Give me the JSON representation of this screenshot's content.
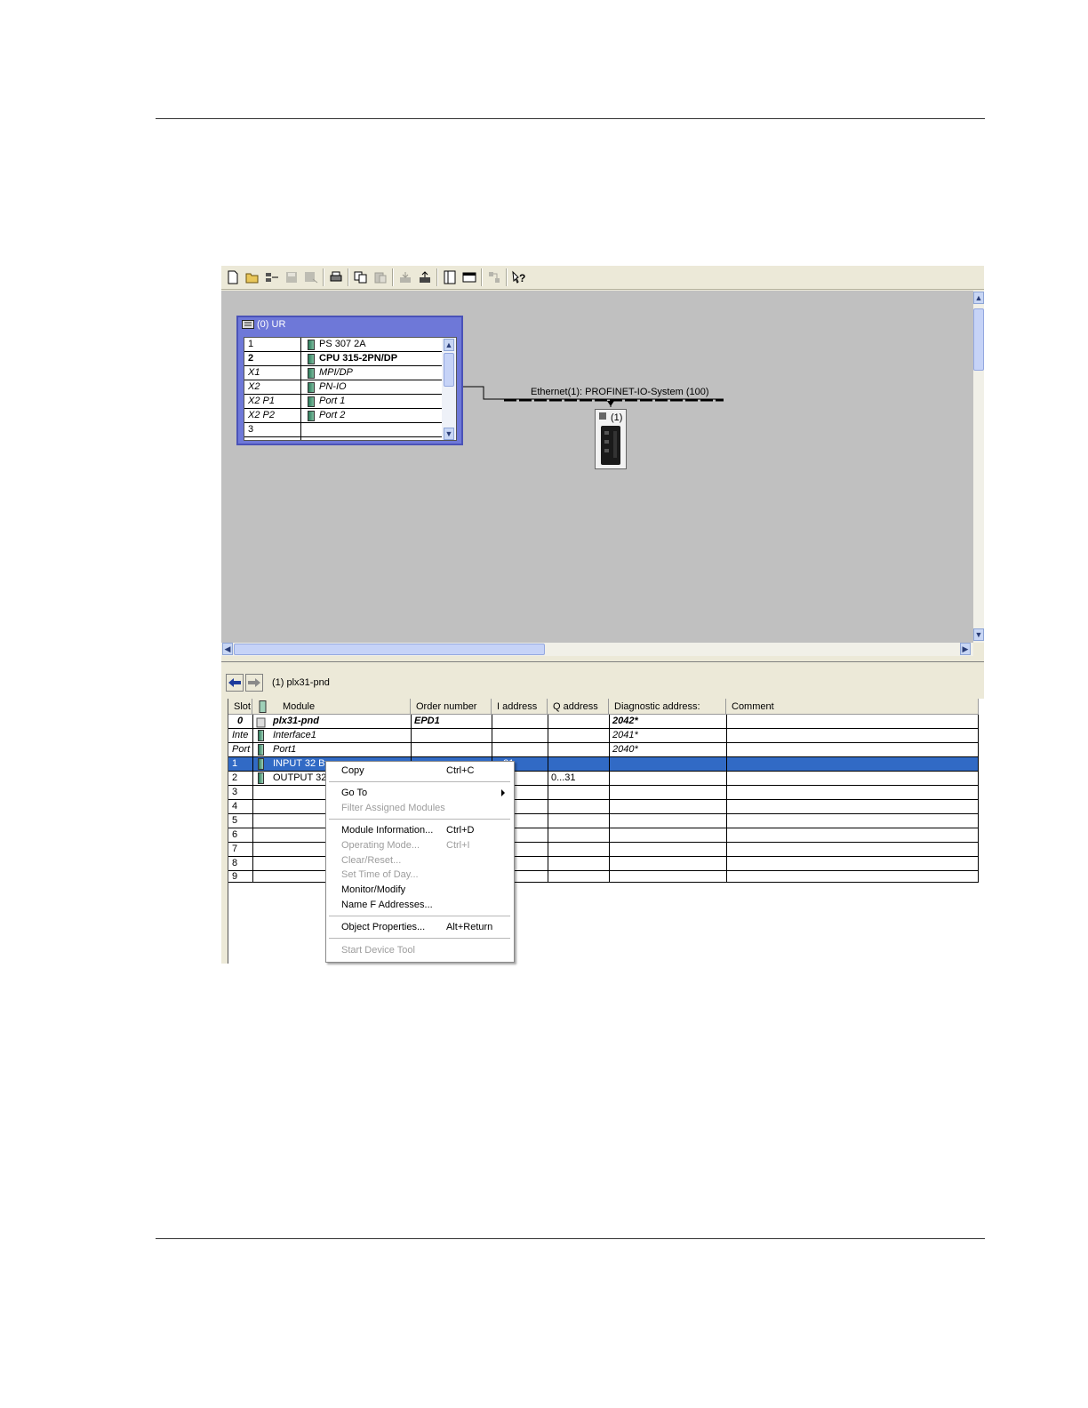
{
  "rack": {
    "title": "(0) UR",
    "rows": [
      {
        "slot": "1",
        "module": "PS 307 2A"
      },
      {
        "slot": "2",
        "module": "CPU 315-2PN/DP"
      },
      {
        "slot": "X1",
        "module": "MPI/DP"
      },
      {
        "slot": "X2",
        "module": "PN-IO"
      },
      {
        "slot": "X2 P1",
        "module": "Port 1"
      },
      {
        "slot": "X2 P2",
        "module": "Port 2"
      },
      {
        "slot": "3",
        "module": ""
      }
    ]
  },
  "network": {
    "bus_label": "Ethernet(1): PROFINET-IO-System (100)",
    "device_label": "(1)"
  },
  "detail": {
    "title": "(1)   plx31-pnd",
    "columns": [
      "Slot",
      "Module",
      "Order number",
      "I address",
      "Q address",
      "Diagnostic address:",
      "Comment"
    ],
    "rows": [
      {
        "slot": "0",
        "module": "plx31-pnd",
        "order": "EPD1",
        "i": "",
        "q": "",
        "diag": "2042*",
        "comment": ""
      },
      {
        "slot": "Inte",
        "module": "Interface1",
        "order": "",
        "i": "",
        "q": "",
        "diag": "2041*",
        "comment": ""
      },
      {
        "slot": "Port",
        "module": "Port1",
        "order": "",
        "i": "",
        "q": "",
        "diag": "2040*",
        "comment": ""
      },
      {
        "slot": "1",
        "module": "INPUT 32 By",
        "order": "",
        "i": "...31",
        "q": "",
        "diag": "",
        "comment": ""
      },
      {
        "slot": "2",
        "module": "OUTPUT 32",
        "order": "",
        "i": "",
        "q": "0...31",
        "diag": "",
        "comment": ""
      },
      {
        "slot": "3",
        "module": "",
        "order": "",
        "i": "",
        "q": "",
        "diag": "",
        "comment": ""
      },
      {
        "slot": "4",
        "module": "",
        "order": "",
        "i": "",
        "q": "",
        "diag": "",
        "comment": ""
      },
      {
        "slot": "5",
        "module": "",
        "order": "",
        "i": "",
        "q": "",
        "diag": "",
        "comment": ""
      },
      {
        "slot": "6",
        "module": "",
        "order": "",
        "i": "",
        "q": "",
        "diag": "",
        "comment": ""
      },
      {
        "slot": "7",
        "module": "",
        "order": "",
        "i": "",
        "q": "",
        "diag": "",
        "comment": ""
      },
      {
        "slot": "8",
        "module": "",
        "order": "",
        "i": "",
        "q": "",
        "diag": "",
        "comment": ""
      },
      {
        "slot": "9",
        "module": "",
        "order": "",
        "i": "",
        "q": "",
        "diag": "",
        "comment": ""
      }
    ]
  },
  "context_menu": {
    "items": [
      {
        "label": "Copy",
        "shortcut": "Ctrl+C",
        "disabled": false
      },
      {
        "label": "Go To",
        "shortcut": "",
        "disabled": false,
        "submenu": true
      },
      {
        "label": "Filter Assigned Modules",
        "shortcut": "",
        "disabled": true
      },
      {
        "label": "Module Information...",
        "shortcut": "Ctrl+D",
        "disabled": false
      },
      {
        "label": "Operating Mode...",
        "shortcut": "Ctrl+I",
        "disabled": true
      },
      {
        "label": "Clear/Reset...",
        "shortcut": "",
        "disabled": true
      },
      {
        "label": "Set Time of Day...",
        "shortcut": "",
        "disabled": true
      },
      {
        "label": "Monitor/Modify",
        "shortcut": "",
        "disabled": false
      },
      {
        "label": "Name F Addresses...",
        "shortcut": "",
        "disabled": false
      },
      {
        "label": "Object Properties...",
        "shortcut": "Alt+Return",
        "disabled": false
      },
      {
        "label": "Start Device Tool",
        "shortcut": "",
        "disabled": true
      }
    ]
  },
  "toolbar": {
    "icons": [
      "new-icon",
      "open-icon",
      "accessible-nodes-icon",
      "save-icon",
      "save-compile-icon",
      "print-icon",
      "copy-icon",
      "paste-icon",
      "download-icon",
      "upload-icon",
      "catalog-icon",
      "window-icon",
      "network-icon",
      "help-icon"
    ]
  },
  "colors": {
    "selection": "#316ac5",
    "rack_frame": "#6e78d8",
    "canvas": "#c0c0c0"
  }
}
